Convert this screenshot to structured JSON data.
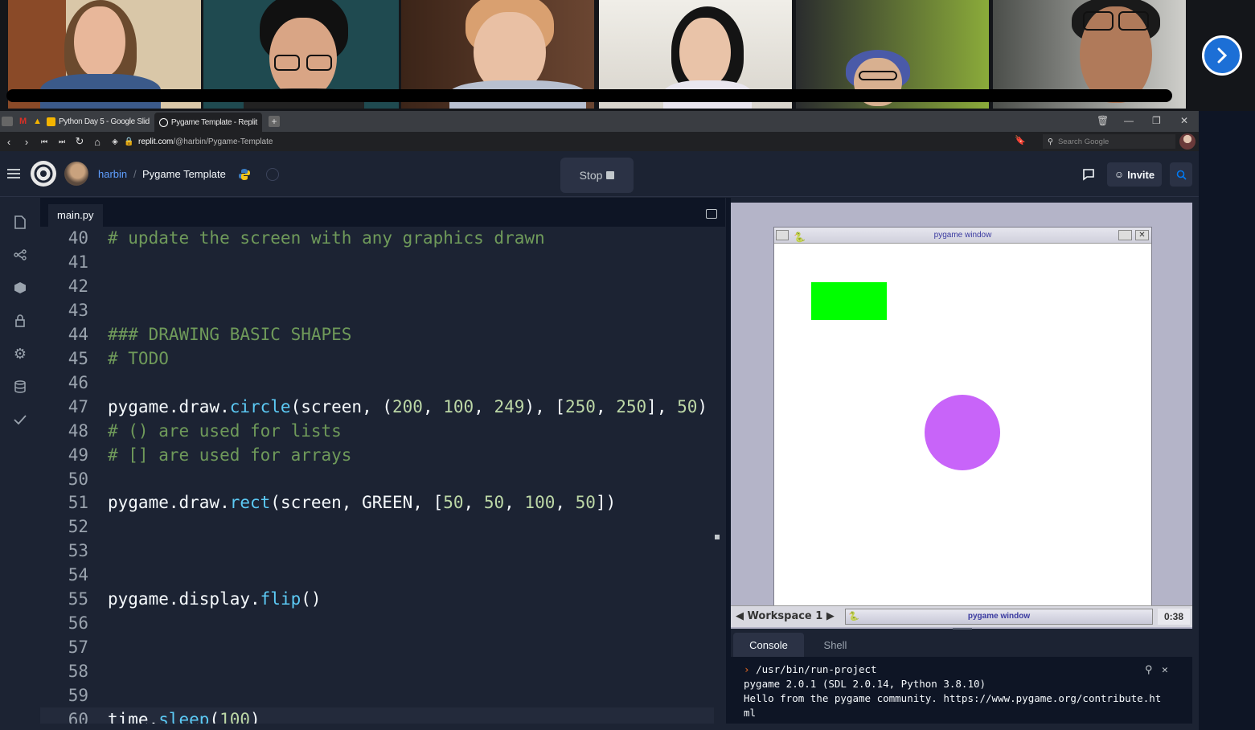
{
  "browser": {
    "tabs": [
      {
        "label": "Python Day 5 - Google Slid",
        "color": "#f4b400"
      },
      {
        "label": "Pygame Template - Replit",
        "color": "#ffffff"
      }
    ],
    "url_host": "replit.com",
    "url_path": "/@harbin/Pygame-Template",
    "search_placeholder": "Search Google"
  },
  "header": {
    "user": "harbin",
    "separator": "/",
    "project": "Pygame Template",
    "stop_label": "Stop",
    "invite_label": "Invite"
  },
  "editor": {
    "file_tab": "main.py",
    "lines": [
      {
        "n": "40",
        "text": "# update the screen with any graphics drawn"
      },
      {
        "n": "41",
        "text": ""
      },
      {
        "n": "42",
        "text": ""
      },
      {
        "n": "43",
        "text": ""
      },
      {
        "n": "44",
        "text": "### DRAWING BASIC SHAPES"
      },
      {
        "n": "45",
        "text": "# TODO"
      },
      {
        "n": "46",
        "text": ""
      },
      {
        "n": "47",
        "text": "pygame.draw.circle(screen, (200, 100, 249), [250, 250], 50)"
      },
      {
        "n": "48",
        "text": "# () are used for lists"
      },
      {
        "n": "49",
        "text": "# [] are used for arrays"
      },
      {
        "n": "50",
        "text": ""
      },
      {
        "n": "51",
        "text": "pygame.draw.rect(screen, GREEN, [50, 50, 100, 50])"
      },
      {
        "n": "52",
        "text": ""
      },
      {
        "n": "53",
        "text": ""
      },
      {
        "n": "54",
        "text": ""
      },
      {
        "n": "55",
        "text": "pygame.display.flip()"
      },
      {
        "n": "56",
        "text": ""
      },
      {
        "n": "57",
        "text": ""
      },
      {
        "n": "58",
        "text": ""
      },
      {
        "n": "59",
        "text": ""
      },
      {
        "n": "60",
        "text": "time.sleep(100)"
      }
    ]
  },
  "pygame": {
    "window_title": "pygame window",
    "workspace": "Workspace 1",
    "taskbar_window": "pygame window",
    "clock": "0:38",
    "rect_color": "#00ff00",
    "circle_color": "#c864f9"
  },
  "console": {
    "tab_console": "Console",
    "tab_shell": "Shell",
    "command": "/usr/bin/run-project",
    "out1": "pygame 2.0.1 (SDL 2.0.14, Python 3.8.10)",
    "out2": "Hello from the pygame community. https://www.pygame.org/contribute.ht",
    "out3": "ml"
  },
  "colors": {
    "accent": "#0079f2",
    "user_link": "#5f9fff",
    "video_highlight": "#9acd32"
  }
}
